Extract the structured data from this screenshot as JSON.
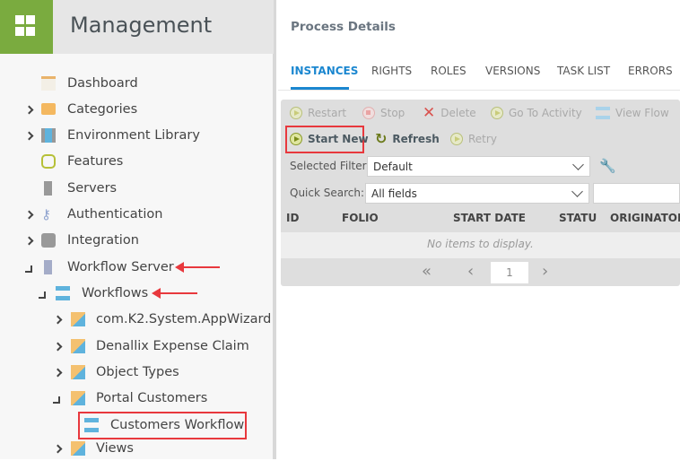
{
  "sidebar": {
    "title": "Management",
    "items": [
      {
        "label": "Dashboard"
      },
      {
        "label": "Categories"
      },
      {
        "label": "Environment Library"
      },
      {
        "label": "Features"
      },
      {
        "label": "Servers"
      },
      {
        "label": "Authentication"
      },
      {
        "label": "Integration"
      },
      {
        "label": "Workflow Server"
      },
      {
        "label": "Workflows"
      },
      {
        "label": "com.K2.System.AppWizard"
      },
      {
        "label": "Denallix Expense Claim"
      },
      {
        "label": "Object Types"
      },
      {
        "label": "Portal Customers"
      },
      {
        "label": "Customers Workflow"
      },
      {
        "label": "Views"
      }
    ]
  },
  "main": {
    "title": "Process Details",
    "tabs": [
      {
        "label": "INSTANCES"
      },
      {
        "label": "RIGHTS"
      },
      {
        "label": "ROLES"
      },
      {
        "label": "VERSIONS"
      },
      {
        "label": "TASK LIST"
      },
      {
        "label": "ERRORS"
      }
    ],
    "toolbar": {
      "restart": "Restart",
      "stop": "Stop",
      "delete": "Delete",
      "goto": "Go To Activity",
      "viewflow": "View Flow",
      "startnew": "Start New",
      "refresh": "Refresh",
      "retry": "Retry"
    },
    "filter": {
      "label": "Selected Filter:",
      "value": "Default"
    },
    "search": {
      "label": "Quick Search:",
      "value": "All fields",
      "text": ""
    },
    "columns": [
      "ID",
      "FOLIO",
      "START DATE",
      "STATUS",
      "ORIGINATOR"
    ],
    "empty": "No items to display.",
    "pager": {
      "page": "1"
    }
  },
  "colors": {
    "accent": "#1b87d0",
    "brand": "#7aab3f",
    "highlight": "#e8383d"
  }
}
